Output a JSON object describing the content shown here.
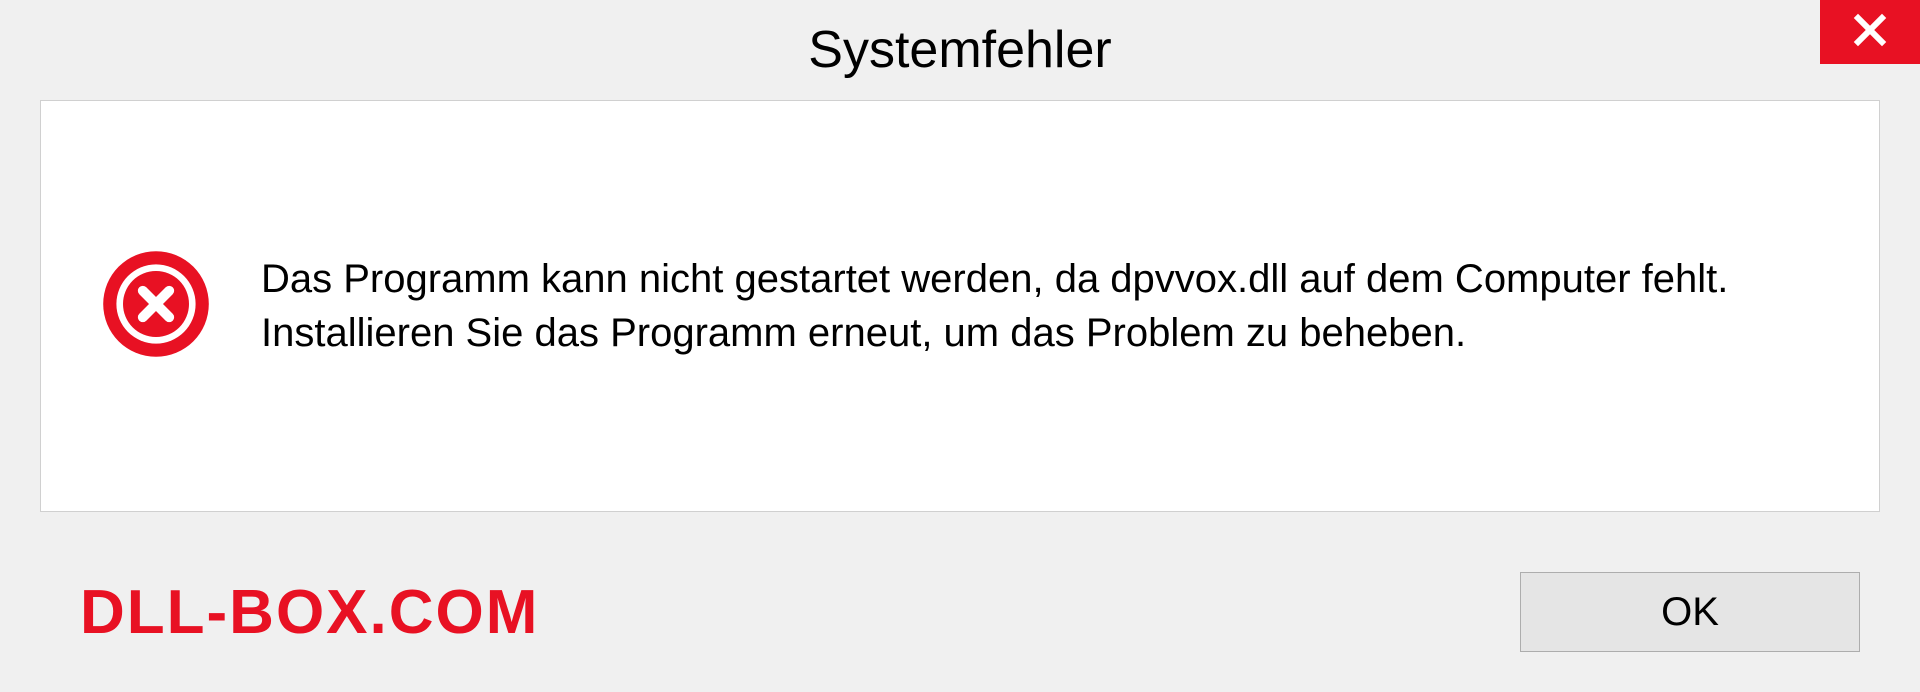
{
  "dialog": {
    "title": "Systemfehler",
    "message": "Das Programm kann nicht gestartet werden, da dpvvox.dll auf dem Computer fehlt. Installieren Sie das Programm erneut, um das Problem zu beheben.",
    "ok_label": "OK"
  },
  "watermark": "DLL-BOX.COM"
}
